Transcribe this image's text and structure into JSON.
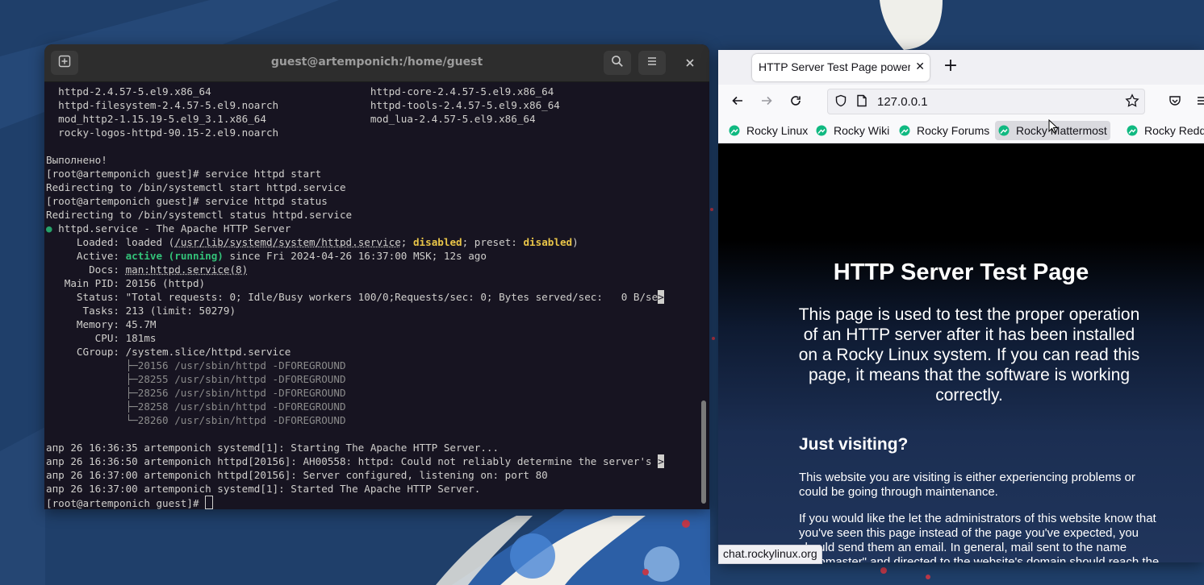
{
  "terminal": {
    "title": "guest@artemponich:/home/guest",
    "lines": [
      {
        "segs": [
          {
            "t": "  httpd-2.4.57-5.el9.x86_64                          httpd-core-2.4.57-5.el9.x86_64"
          }
        ]
      },
      {
        "segs": [
          {
            "t": "  httpd-filesystem-2.4.57-5.el9.noarch               httpd-tools-2.4.57-5.el9.x86_64"
          }
        ]
      },
      {
        "segs": [
          {
            "t": "  mod_http2-1.15.19-5.el9_3.1.x86_64                 mod_lua-2.4.57-5.el9.x86_64"
          }
        ]
      },
      {
        "segs": [
          {
            "t": "  rocky-logos-httpd-90.15-2.el9.noarch"
          }
        ]
      },
      {
        "segs": [
          {
            "t": ""
          }
        ]
      },
      {
        "segs": [
          {
            "t": "Выполнено!"
          }
        ]
      },
      {
        "segs": [
          {
            "t": "[root@artemponich guest]# service httpd start"
          }
        ]
      },
      {
        "segs": [
          {
            "t": "Redirecting to /bin/systemctl start httpd.service"
          }
        ]
      },
      {
        "segs": [
          {
            "t": "[root@artemponich guest]# service httpd status"
          }
        ]
      },
      {
        "segs": [
          {
            "t": "Redirecting to /bin/systemctl status httpd.service"
          }
        ]
      },
      {
        "segs": [
          {
            "t": "●",
            "c": "green"
          },
          {
            "t": " httpd.service - The Apache HTTP Server"
          }
        ]
      },
      {
        "segs": [
          {
            "t": "     Loaded: loaded ("
          },
          {
            "t": "/usr/lib/systemd/system/httpd.service",
            "c": "ul"
          },
          {
            "t": "; "
          },
          {
            "t": "disabled",
            "c": "yellowb"
          },
          {
            "t": "; preset: "
          },
          {
            "t": "disabled",
            "c": "yellowb"
          },
          {
            "t": ")"
          }
        ]
      },
      {
        "segs": [
          {
            "t": "     Active: "
          },
          {
            "t": "active (running)",
            "c": "greenb"
          },
          {
            "t": " since Fri 2024-04-26 16:37:00 MSK; 12s ago"
          }
        ]
      },
      {
        "segs": [
          {
            "t": "       Docs: "
          },
          {
            "t": "man:httpd.service(8)",
            "c": "ul"
          }
        ]
      },
      {
        "segs": [
          {
            "t": "   Main PID: 20156 (httpd)"
          }
        ]
      },
      {
        "segs": [
          {
            "t": "     Status: \"Total requests: 0; Idle/Busy workers 100/0;Requests/sec: 0; Bytes served/sec:   0 B/se"
          },
          {
            "t": ">",
            "c": "clip"
          }
        ]
      },
      {
        "segs": [
          {
            "t": "      Tasks: 213 (limit: 50279)"
          }
        ]
      },
      {
        "segs": [
          {
            "t": "     Memory: 45.7M"
          }
        ]
      },
      {
        "segs": [
          {
            "t": "        CPU: 181ms"
          }
        ]
      },
      {
        "segs": [
          {
            "t": "     CGroup: /system.slice/httpd.service"
          }
        ]
      },
      {
        "segs": [
          {
            "t": "             ├─20156 /usr/sbin/httpd -DFOREGROUND",
            "c": "dim"
          }
        ]
      },
      {
        "segs": [
          {
            "t": "             ├─28255 /usr/sbin/httpd -DFOREGROUND",
            "c": "dim"
          }
        ]
      },
      {
        "segs": [
          {
            "t": "             ├─28256 /usr/sbin/httpd -DFOREGROUND",
            "c": "dim"
          }
        ]
      },
      {
        "segs": [
          {
            "t": "             ├─28258 /usr/sbin/httpd -DFOREGROUND",
            "c": "dim"
          }
        ]
      },
      {
        "segs": [
          {
            "t": "             └─28260 /usr/sbin/httpd -DFOREGROUND",
            "c": "dim"
          }
        ]
      },
      {
        "segs": [
          {
            "t": ""
          }
        ]
      },
      {
        "segs": [
          {
            "t": "апр 26 16:36:35 artemponich systemd[1]: Starting The Apache HTTP Server..."
          }
        ]
      },
      {
        "segs": [
          {
            "t": "апр 26 16:36:50 artemponich httpd[20156]: AH00558: httpd: Could not reliably determine the server's "
          },
          {
            "t": ">",
            "c": "clip"
          }
        ]
      },
      {
        "segs": [
          {
            "t": "апр 26 16:37:00 artemponich httpd[20156]: Server configured, listening on: port 80"
          }
        ]
      },
      {
        "segs": [
          {
            "t": "апр 26 16:37:00 artemponich systemd[1]: Started The Apache HTTP Server."
          }
        ]
      },
      {
        "segs": [
          {
            "t": "[root@artemponich guest]# "
          }
        ],
        "cursor": true
      }
    ]
  },
  "browser": {
    "tab_title": "HTTP Server Test Page powered by",
    "tab_close": "✕",
    "new_tab": "+",
    "url": "127.0.0.1",
    "bookmarks": [
      "Rocky Linux",
      "Rocky Wiki",
      "Rocky Forums",
      "Rocky Mattermost",
      "Rocky Reddit"
    ],
    "accent_color": "#10b981",
    "page": {
      "heading": "HTTP Server Test Page",
      "lead": "This page is used to test the proper operation of an HTTP server after it has been installed on a Rocky Linux system. If you can read this page, it means that the software is working correctly.",
      "subheading": "Just visiting?",
      "para1": "This website you are visiting is either experiencing problems or could be going through maintenance.",
      "para2": "If you would like the let the administrators of this website know that you've seen this page instead of the page you've expected, you should send them an email. In general, mail sent to the name \"webmaster\" and directed to the website's domain should reach the appropriate person."
    },
    "status_link": "chat.rockylinux.org"
  }
}
